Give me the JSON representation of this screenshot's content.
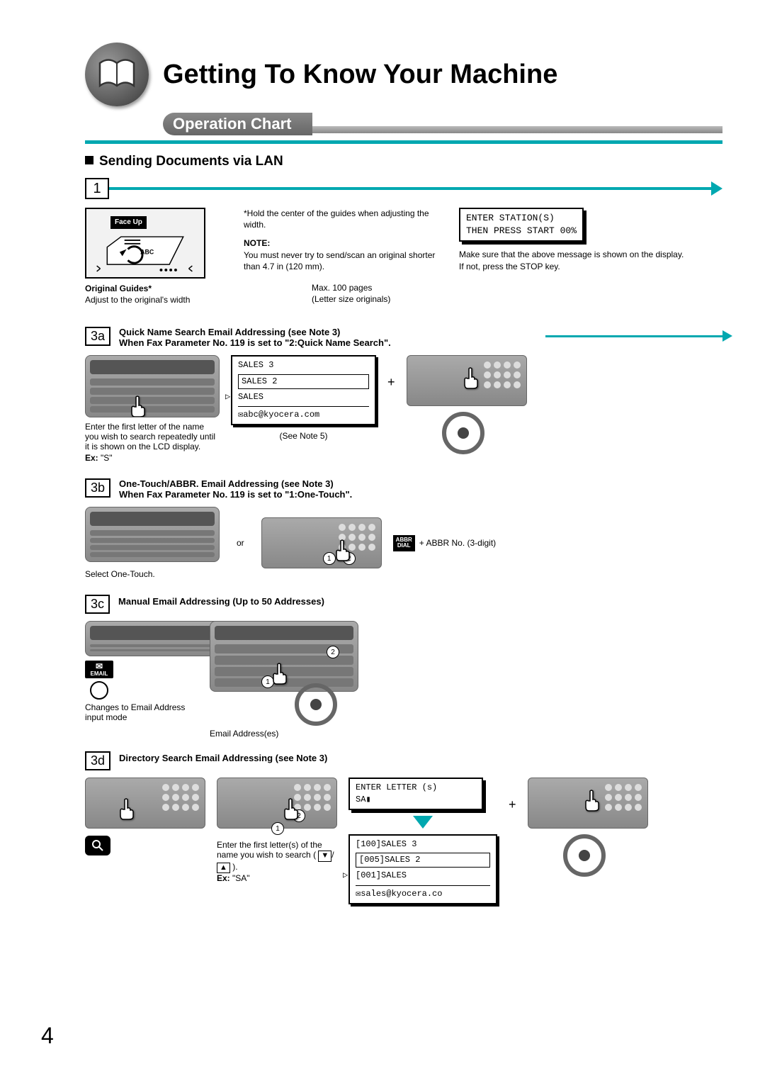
{
  "title": "Getting To Know Your Machine",
  "subtitle": "Operation Chart",
  "section": "Sending Documents via LAN",
  "step1": {
    "num": "1",
    "face_up": "Face Up",
    "orig_guides_label": "Original Guides*",
    "orig_guides_text": "Adjust to the original's width",
    "guides_note": "*Hold the center of the guides when adjusting the width.",
    "note_label": "NOTE:",
    "note_text": "You must never try to send/scan an original shorter than 4.7 in (120 mm).",
    "max_pages": "Max. 100 pages",
    "letter_size": "(Letter size originals)",
    "lcd_line1": "ENTER STATION(S)",
    "lcd_line2": "THEN PRESS START 00%",
    "lcd_below1": "Make sure that the above message is shown on the display.",
    "lcd_below2": "If not, press the STOP key."
  },
  "s3a": {
    "num": "3a",
    "heading1": "Quick Name Search Email Addressing (see Note 3)",
    "heading2": "When Fax Parameter No. 119 is set to \"2:Quick Name Search\".",
    "l1": "SALES 3",
    "l2": "SALES 2",
    "l3": "SALES",
    "l4": "abc@kyocera.com",
    "under_panel": "Enter the first letter of the name you wish to search repeatedly until it is shown on the LCD display.",
    "ex_label": "Ex:",
    "ex_val": "\"S\"",
    "see_note": "(See Note 5)",
    "plus": "+"
  },
  "s3b": {
    "num": "3b",
    "heading1": "One-Touch/ABBR. Email Addressing (see Note 3)",
    "heading2": "When Fax Parameter No. 119 is set to \"1:One-Touch\".",
    "select": "Select One-Touch.",
    "or": "or",
    "abbr_box1": "ABBR",
    "abbr_box2": "DIAL",
    "abbr_right": "+ ABBR No. (3-digit)"
  },
  "s3c": {
    "num": "3c",
    "heading": "Manual Email Addressing (Up to 50 Addresses)",
    "email_label": "EMAIL",
    "changes": "Changes to Email Address input mode",
    "email_addr": "Email Address(es)"
  },
  "s3d": {
    "num": "3d",
    "heading": "Directory Search Email Addressing (see Note 3)",
    "enter_first": "Enter the first letter(s) of the name you wish to search (",
    "enter_first_end": ").",
    "ex_label": "Ex:",
    "ex_val": "\"SA\"",
    "lcd_top1": "ENTER LETTER (s)",
    "lcd_top2": "SA▮",
    "r1": "[100]SALES 3",
    "r2": "[005]SALES 2",
    "r3": "[001]SALES",
    "r4": "sales@kyocera.co",
    "plus": "+"
  },
  "page_no": "4"
}
